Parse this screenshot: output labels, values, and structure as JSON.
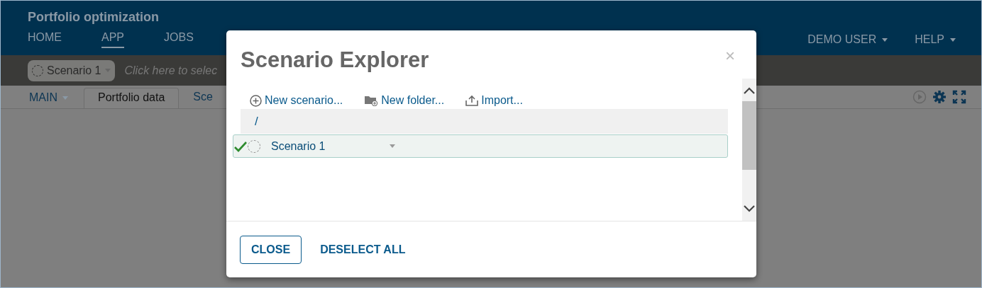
{
  "app": {
    "title": "Portfolio optimization"
  },
  "nav": [
    {
      "label": "HOME",
      "selected": false
    },
    {
      "label": "APP",
      "selected": true
    },
    {
      "label": "JOBS",
      "selected": false
    }
  ],
  "user_menus": [
    "DEMO USER",
    "HELP"
  ],
  "scenario_bar": {
    "chip": "Scenario 1",
    "placeholder": "Click here to selec"
  },
  "view_tabs": {
    "menu": "MAIN",
    "tabs": [
      {
        "label": "Portfolio data",
        "selected": true
      },
      {
        "label": "Sce",
        "selected": false
      }
    ]
  },
  "dialog": {
    "title": "Scenario Explorer",
    "close": "×",
    "actions": [
      {
        "kind": "scenario",
        "label": "New scenario..."
      },
      {
        "kind": "folder",
        "label": "New folder..."
      },
      {
        "kind": "import",
        "label": "Import..."
      }
    ],
    "path": "/",
    "scenarios": [
      {
        "name": "Scenario 1",
        "checked": true,
        "selected": true
      }
    ],
    "buttons": [
      {
        "kind": "outline",
        "label": "CLOSE"
      },
      {
        "kind": "link",
        "label": "DESELECT ALL"
      }
    ]
  }
}
